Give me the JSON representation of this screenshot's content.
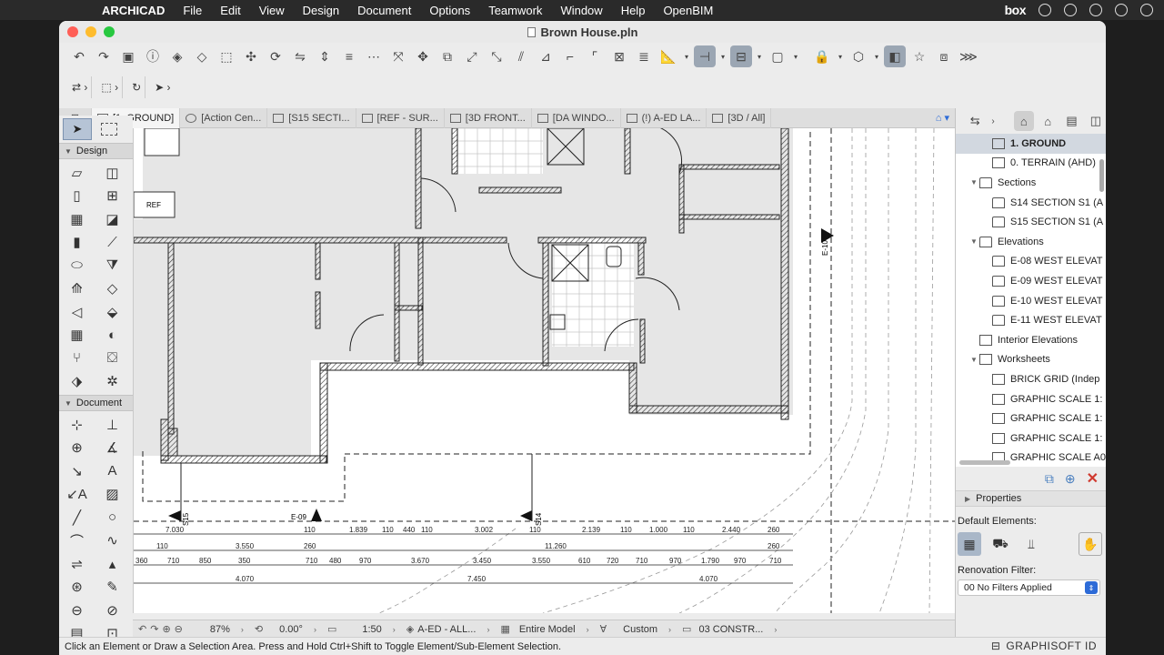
{
  "menubar": {
    "app_name": "ARCHICAD",
    "items": [
      "File",
      "Edit",
      "View",
      "Design",
      "Document",
      "Options",
      "Teamwork",
      "Window",
      "Help",
      "OpenBIM"
    ],
    "box_label": "box"
  },
  "window": {
    "title": "Brown House.pln"
  },
  "tabs": [
    {
      "label": "[1. GROUND]",
      "active": true
    },
    {
      "label": "[Action Cen..."
    },
    {
      "label": "[S15 SECTI..."
    },
    {
      "label": "[REF - SUR..."
    },
    {
      "label": "[3D FRONT..."
    },
    {
      "label": "[DA WINDO..."
    },
    {
      "label": "(!) A-ED LA..."
    },
    {
      "label": "[3D / All]"
    }
  ],
  "toolbox": {
    "design_label": "Design",
    "document_label": "Document"
  },
  "drawing": {
    "ref_tag": "REF",
    "markers": [
      "E-10",
      "E-09",
      "S15",
      "S14"
    ],
    "dims_row1": [
      "7.030",
      "110",
      "1.839",
      "110",
      "440",
      "110",
      "3.002",
      "110",
      "2.139",
      "110",
      "1.000",
      "110",
      "2.440",
      "260"
    ],
    "dims_row2": [
      "110",
      "3.550",
      "260",
      "11.260",
      "260"
    ],
    "dims_row3": [
      "360",
      "710",
      "850",
      "350",
      "710",
      "480",
      "970",
      "3.670",
      "3.450",
      "3.550",
      "610",
      "720",
      "710",
      "970",
      "1.790",
      "970",
      "710"
    ],
    "dims_row4": [
      "4.070",
      "7.450",
      "4.070"
    ]
  },
  "bottombar": {
    "zoom": "87%",
    "angle": "0.00°",
    "scale": "1:50",
    "layer_combo": "A-ED - ALL...",
    "model_view": "Entire Model",
    "pen_set": "Custom",
    "graphic_override": "03 CONSTR..."
  },
  "status": {
    "message": "Click an Element or Draw a Selection Area. Press and Hold Ctrl+Shift to Toggle Element/Sub-Element Selection.",
    "brand": "GRAPHISOFT ID"
  },
  "navigator": {
    "items": [
      {
        "label": "1. GROUND",
        "level": 2,
        "selected": true
      },
      {
        "label": "0. TERRAIN (AHD)",
        "level": 2
      },
      {
        "label": "Sections",
        "level": 1,
        "folder": true
      },
      {
        "label": "S14 SECTION S1 (A",
        "level": 2
      },
      {
        "label": "S15 SECTION S1 (A",
        "level": 2
      },
      {
        "label": "Elevations",
        "level": 1,
        "folder": true
      },
      {
        "label": "E-08 WEST ELEVAT",
        "level": 2
      },
      {
        "label": "E-09 WEST ELEVAT",
        "level": 2
      },
      {
        "label": "E-10 WEST ELEVAT",
        "level": 2
      },
      {
        "label": "E-11 WEST ELEVAT",
        "level": 2
      },
      {
        "label": "Interior Elevations",
        "level": 1
      },
      {
        "label": "Worksheets",
        "level": 1,
        "folder": true
      },
      {
        "label": "BRICK GRID (Indep",
        "level": 2
      },
      {
        "label": "GRAPHIC SCALE 1:",
        "level": 2
      },
      {
        "label": "GRAPHIC SCALE 1:",
        "level": 2
      },
      {
        "label": "GRAPHIC SCALE 1:",
        "level": 2
      },
      {
        "label": "GRAPHIC SCALE A0",
        "level": 2
      }
    ],
    "properties_label": "Properties",
    "default_elements_label": "Default Elements:",
    "renovation_label": "Renovation Filter:",
    "renovation_value": "00 No Filters Applied"
  }
}
